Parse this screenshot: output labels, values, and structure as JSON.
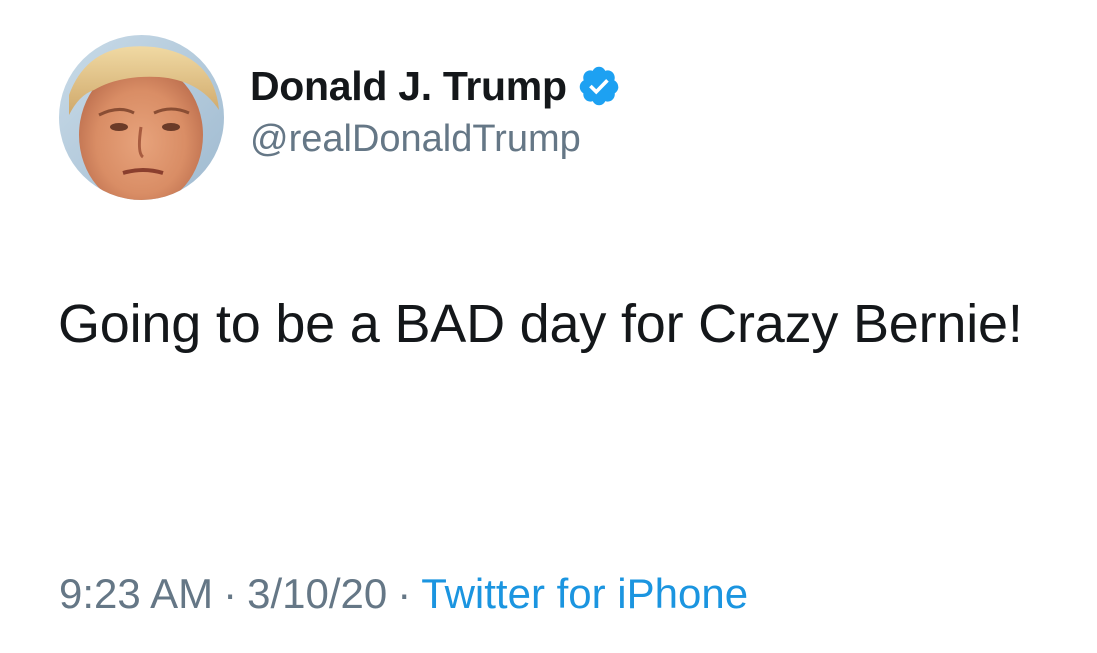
{
  "author": {
    "display_name": "Donald J. Trump",
    "handle": "@realDonaldTrump",
    "verified_icon": "verified-badge-icon",
    "avatar_icon": "profile-photo"
  },
  "tweet": {
    "text": "Going to be a BAD day for Crazy Bernie!"
  },
  "meta": {
    "time": "9:23 AM",
    "separator": "·",
    "date": "3/10/20",
    "source": "Twitter for iPhone"
  },
  "colors": {
    "text_primary": "#14171a",
    "text_secondary": "#657786",
    "link": "#1b95e0",
    "verified": "#1da1f2"
  }
}
